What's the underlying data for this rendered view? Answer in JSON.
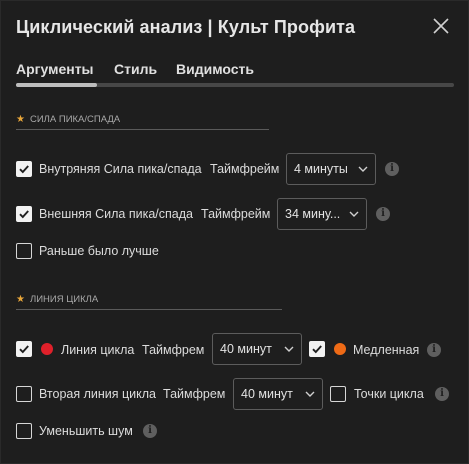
{
  "header": {
    "title": "Циклический анализ | Культ Профита",
    "close_icon": "close-icon"
  },
  "tabs": [
    {
      "label": "Аргументы",
      "active": true
    },
    {
      "label": "Стиль",
      "active": false
    },
    {
      "label": "Видимость",
      "active": false
    }
  ],
  "section_peak": {
    "title": "СИЛА ПИКА/СПАДА",
    "internal": {
      "checked": true,
      "label": "Внутряняя Сила пика/спада",
      "timeframe_label": "Таймфрейм",
      "timeframe_value": "4 минуты"
    },
    "external": {
      "checked": true,
      "label": "Внешняя Сила пика/спада",
      "timeframe_label": "Таймфрейм",
      "timeframe_value": "34 мину..."
    },
    "earlier": {
      "checked": false,
      "label": "Раньше было лучше"
    }
  },
  "section_cycle": {
    "title": "ЛИНИЯ ЦИКЛА",
    "cycle_line": {
      "checked": true,
      "color": "#e0202a",
      "label": "Линия цикла",
      "timeframe_label": "Таймфрем",
      "timeframe_value": "40 минут"
    },
    "slow": {
      "checked": true,
      "color": "#ee6a16",
      "label": "Медленная"
    },
    "second_line": {
      "checked": false,
      "label": "Вторая линия цикла",
      "timeframe_label": "Таймфрем",
      "timeframe_value": "40 минут"
    },
    "points": {
      "checked": false,
      "label": "Точки цикла"
    },
    "noise": {
      "checked": false,
      "label": "Уменьшить шум"
    }
  },
  "info_glyph": "i"
}
